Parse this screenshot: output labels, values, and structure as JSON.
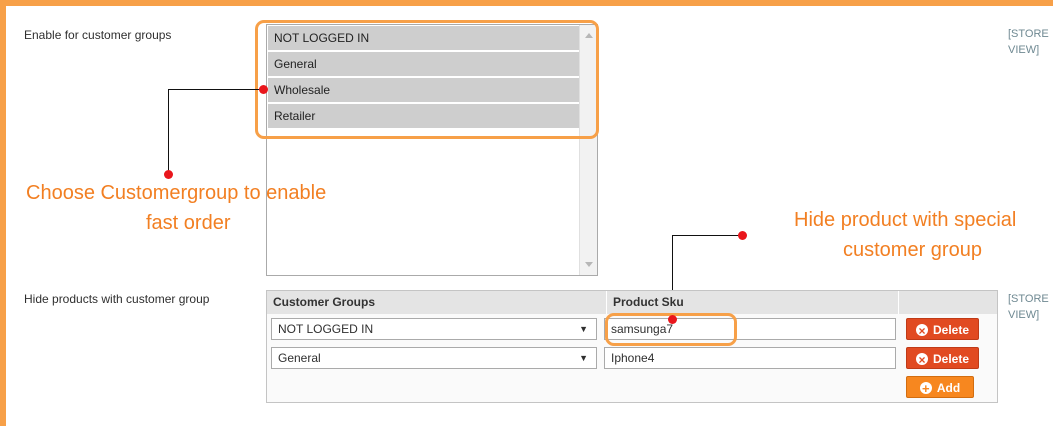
{
  "customer_groups_field": {
    "label": "Enable for customer groups",
    "scope": [
      "[STORE",
      "VIEW]"
    ],
    "options": [
      "NOT LOGGED IN",
      "General",
      "Wholesale",
      "Retailer"
    ]
  },
  "annotations": {
    "choose_group_line1": "Choose Customergroup to enable",
    "choose_group_line2": "fast order",
    "hide_product_line1": "Hide product with special",
    "hide_product_line2": "customer group"
  },
  "hide_products_field": {
    "label": "Hide products with customer group",
    "scope": [
      "[STORE",
      "VIEW]"
    ],
    "columns": [
      "Customer Groups",
      "Product Sku"
    ],
    "rows": [
      {
        "group": "NOT LOGGED IN",
        "sku": "samsunga7",
        "delete_label": "Delete"
      },
      {
        "group": "General",
        "sku": "Iphone4",
        "delete_label": "Delete"
      }
    ],
    "add_label": "Add"
  },
  "colors": {
    "accent": "#f7a048",
    "annotation_text": "#f27f22",
    "marker": "#e9161c",
    "delete_button": "#e14a21",
    "add_button": "#f7871f"
  }
}
